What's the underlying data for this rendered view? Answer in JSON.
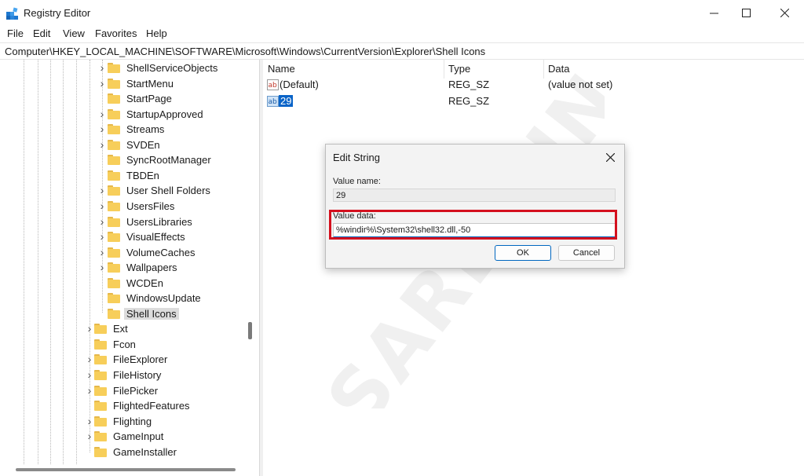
{
  "window": {
    "title": "Registry Editor"
  },
  "menu": [
    "File",
    "Edit",
    "View",
    "Favorites",
    "Help"
  ],
  "address": "Computer\\HKEY_LOCAL_MACHINE\\SOFTWARE\\Microsoft\\Windows\\CurrentVersion\\Explorer\\Shell Icons",
  "tree": {
    "explorer_children": [
      {
        "label": "ShellServiceObjects",
        "expandable": true
      },
      {
        "label": "StartMenu",
        "expandable": true
      },
      {
        "label": "StartPage",
        "expandable": false
      },
      {
        "label": "StartupApproved",
        "expandable": true
      },
      {
        "label": "Streams",
        "expandable": true
      },
      {
        "label": "SVDEn",
        "expandable": true
      },
      {
        "label": "SyncRootManager",
        "expandable": false
      },
      {
        "label": "TBDEn",
        "expandable": false
      },
      {
        "label": "User Shell Folders",
        "expandable": true
      },
      {
        "label": "UsersFiles",
        "expandable": true
      },
      {
        "label": "UsersLibraries",
        "expandable": true
      },
      {
        "label": "VisualEffects",
        "expandable": true
      },
      {
        "label": "VolumeCaches",
        "expandable": true
      },
      {
        "label": "Wallpapers",
        "expandable": true
      },
      {
        "label": "WCDEn",
        "expandable": false
      },
      {
        "label": "WindowsUpdate",
        "expandable": false
      },
      {
        "label": "Shell Icons",
        "expandable": false,
        "selected": true
      }
    ],
    "siblings": [
      {
        "label": "Ext",
        "expandable": true
      },
      {
        "label": "Fcon",
        "expandable": false
      },
      {
        "label": "FileExplorer",
        "expandable": true
      },
      {
        "label": "FileHistory",
        "expandable": true
      },
      {
        "label": "FilePicker",
        "expandable": true
      },
      {
        "label": "FlightedFeatures",
        "expandable": false
      },
      {
        "label": "Flighting",
        "expandable": true
      },
      {
        "label": "GameInput",
        "expandable": true
      },
      {
        "label": "GameInstaller",
        "expandable": false
      }
    ]
  },
  "columns": {
    "name": "Name",
    "type": "Type",
    "data": "Data"
  },
  "values": [
    {
      "name": "(Default)",
      "type": "REG_SZ",
      "data": "(value not set)"
    },
    {
      "name": "29",
      "type": "REG_SZ",
      "data": ""
    }
  ],
  "dialog": {
    "title": "Edit String",
    "value_name_label": "Value name:",
    "value_name": "29",
    "value_data_label": "Value data:",
    "value_data": "%windir%\\System32\\shell32.dll,-50",
    "ok_label": "OK",
    "cancel_label": "Cancel"
  },
  "watermark": "SARDMIN",
  "colors": {
    "selection": "#0a64c8",
    "highlight_box": "#d4101e",
    "folder": "#f7ce5a"
  }
}
